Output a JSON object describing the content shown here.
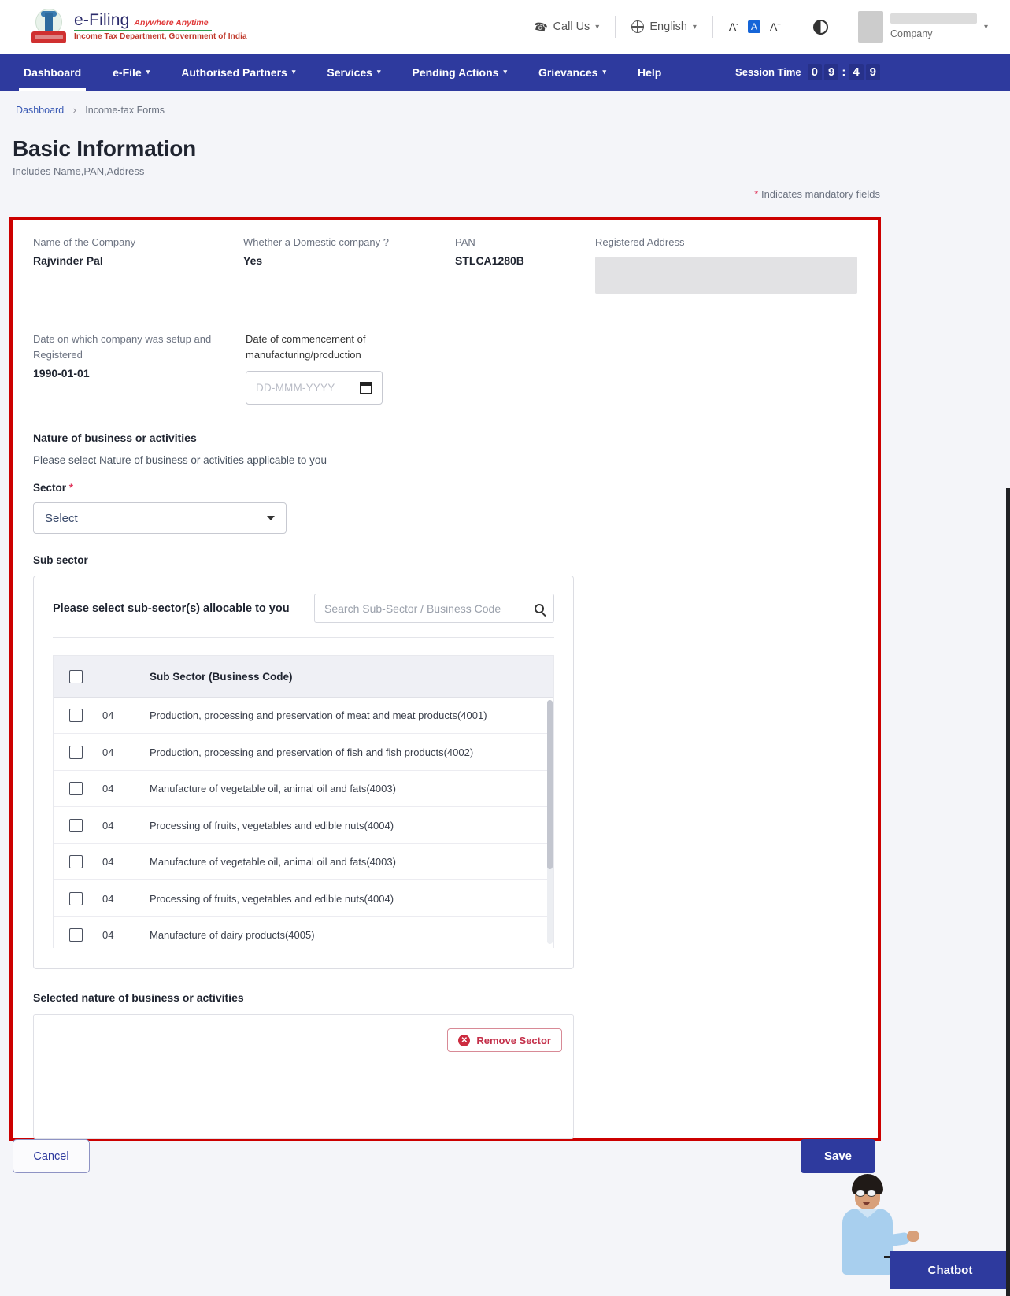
{
  "header": {
    "brand_name": "e-Filing",
    "brand_tagline": "Anywhere Anytime",
    "brand_dept": "Income Tax Department, Government of India",
    "call_us": "Call Us",
    "language": "English",
    "font_decrease": "A",
    "font_normal": "A",
    "font_increase": "A",
    "profile_role": "Company",
    "icons": {
      "phone": "phone-icon",
      "globe": "globe-icon",
      "contrast": "contrast-icon",
      "chevron": "chevron-down-icon"
    }
  },
  "nav": {
    "items": [
      {
        "label": "Dashboard",
        "has_caret": false,
        "active": true
      },
      {
        "label": "e-File",
        "has_caret": true,
        "active": false
      },
      {
        "label": "Authorised Partners",
        "has_caret": true,
        "active": false
      },
      {
        "label": "Services",
        "has_caret": true,
        "active": false
      },
      {
        "label": "Pending Actions",
        "has_caret": true,
        "active": false
      },
      {
        "label": "Grievances",
        "has_caret": true,
        "active": false
      },
      {
        "label": "Help",
        "has_caret": false,
        "active": false
      }
    ],
    "session_label": "Session Time",
    "session_digits": [
      "0",
      "9",
      "4",
      "9"
    ],
    "session_time": "09:49"
  },
  "breadcrumb": {
    "root": "Dashboard",
    "separator": "›",
    "current": "Income-tax Forms"
  },
  "page": {
    "title": "Basic Information",
    "subtitle": "Includes Name,PAN,Address",
    "mandatory_note": "Indicates mandatory fields",
    "mandatory_star": "*"
  },
  "form": {
    "company_name_label": "Name of the Company",
    "company_name_value": "Rajvinder Pal",
    "domestic_label": "Whether a Domestic company ?",
    "domestic_value": "Yes",
    "pan_label": "PAN",
    "pan_value": "STLCA1280B",
    "address_label": "Registered Address",
    "address_value": "",
    "setup_label": "Date on which company was setup and Registered",
    "setup_value": "1990-01-01",
    "commencement_label": "Date of commencement of manufacturing/production",
    "commencement_placeholder": "DD-MMM-YYYY",
    "calendar_icon": "calendar-icon"
  },
  "nature": {
    "heading": "Nature of business or activities",
    "description": "Please select Nature of business or activities applicable to you",
    "sector_label": "Sector",
    "sector_required": "*",
    "sector_selected": "Select",
    "subsector_label": "Sub sector"
  },
  "subsector_panel": {
    "title": "Please select sub-sector(s) allocable to you",
    "search_placeholder": "Search Sub-Sector / Business Code",
    "search_value": "",
    "search_icon": "search-icon",
    "columns": [
      "",
      "",
      "Sub Sector (Business Code)"
    ],
    "header_checkbox_checked": false,
    "rows": [
      {
        "checked": false,
        "code": "04",
        "description": "Production, processing and preservation of meat and meat products(4001)"
      },
      {
        "checked": false,
        "code": "04",
        "description": "Production, processing and preservation of fish and fish products(4002)"
      },
      {
        "checked": false,
        "code": "04",
        "description": "Manufacture of vegetable oil, animal oil and fats(4003)"
      },
      {
        "checked": false,
        "code": "04",
        "description": "Processing of fruits, vegetables and edible nuts(4004)"
      },
      {
        "checked": false,
        "code": "04",
        "description": "Manufacture of vegetable oil, animal oil and fats(4003)"
      },
      {
        "checked": false,
        "code": "04",
        "description": "Processing of fruits, vegetables and edible nuts(4004)"
      },
      {
        "checked": false,
        "code": "04",
        "description": "Manufacture of dairy products(4005)"
      }
    ]
  },
  "selected_nature": {
    "label": "Selected nature of business or activities",
    "remove_button": "Remove Sector",
    "remove_icon": "close-circle-icon",
    "items": []
  },
  "footer": {
    "cancel": "Cancel",
    "save": "Save"
  },
  "chatbot": {
    "label": "Chatbot"
  },
  "colors": {
    "nav_blue": "#2e3a9e",
    "highlight_red": "#cc0000",
    "danger": "#cc2b3f",
    "link": "#3b5bb5",
    "page_bg": "#f4f5f9"
  }
}
